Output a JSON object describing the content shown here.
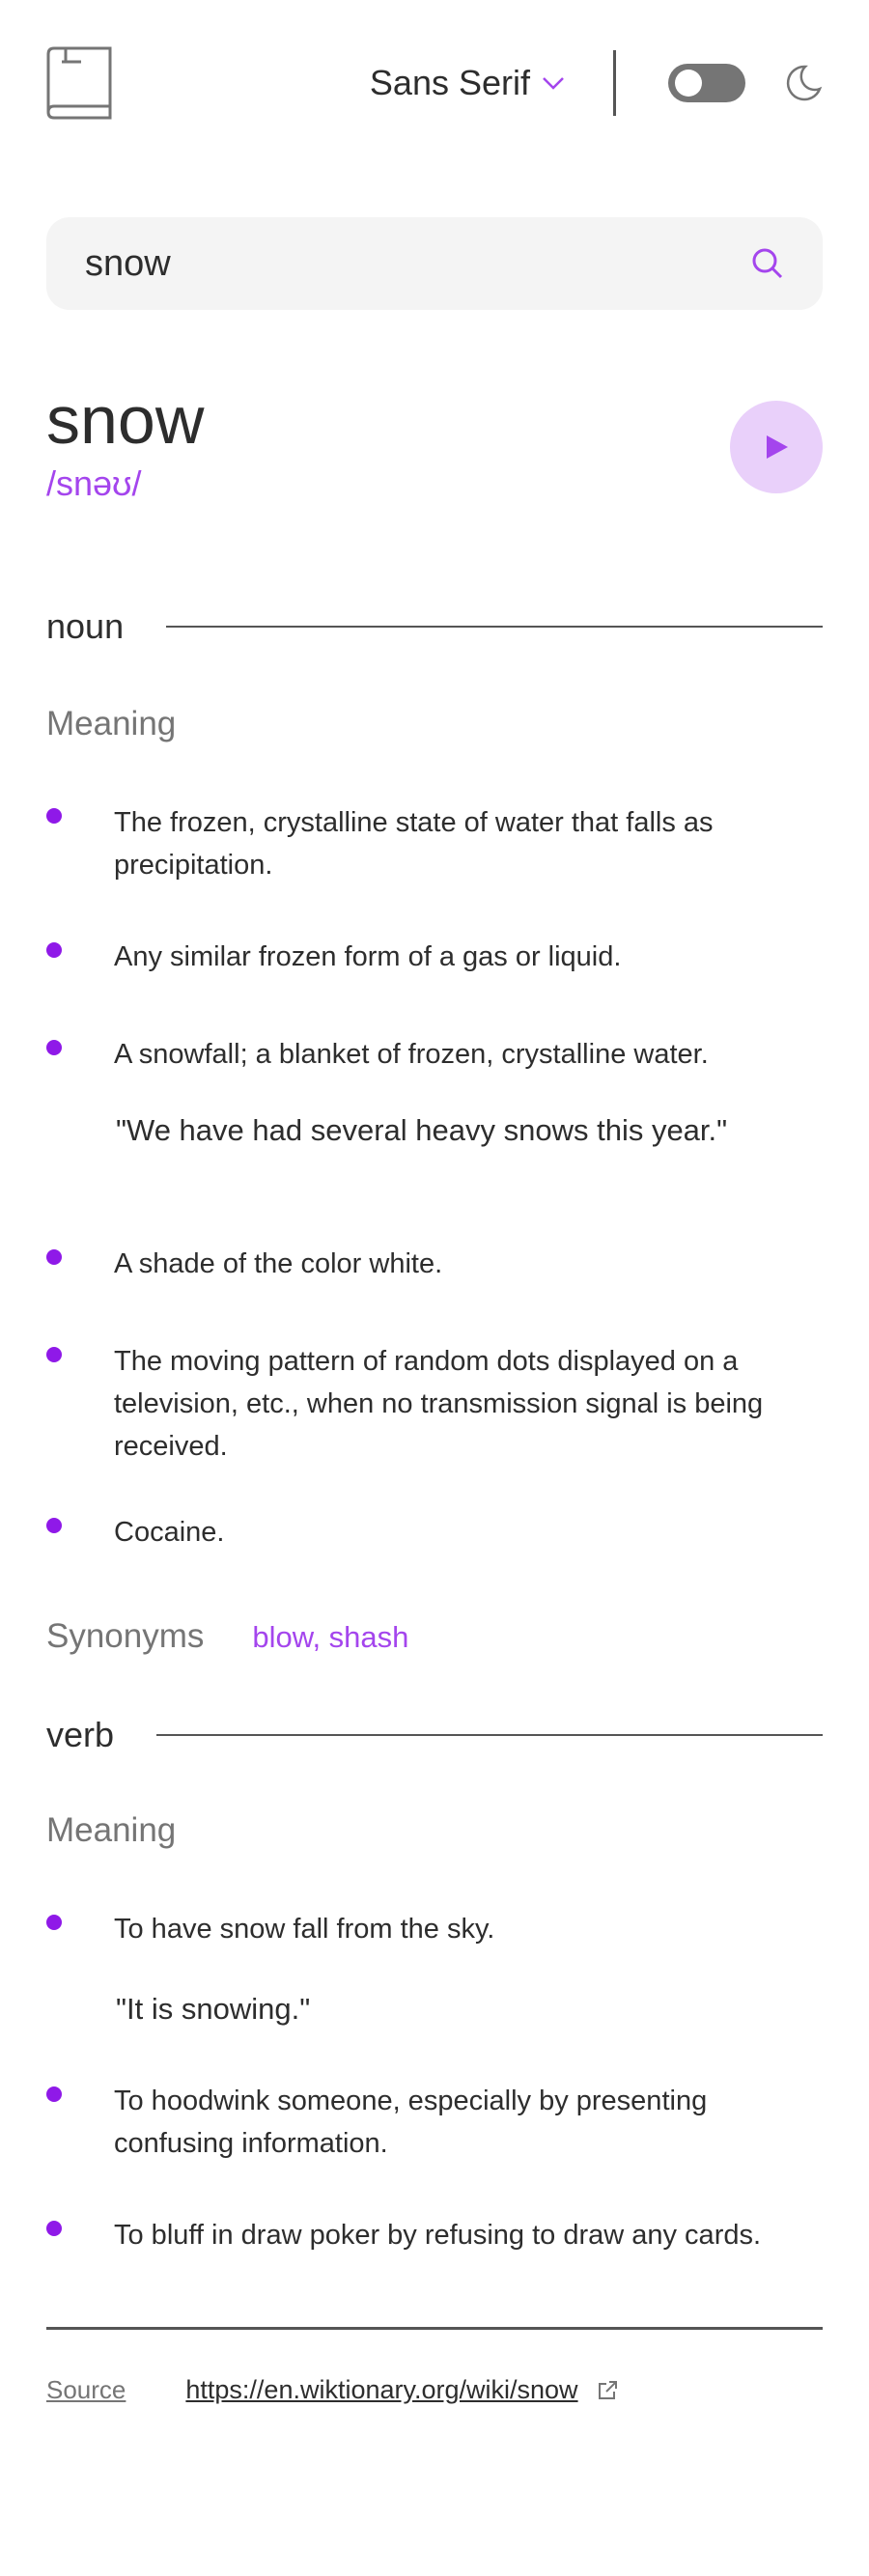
{
  "header": {
    "font_select_label": "Sans Serif",
    "icons": {
      "logo": "book-icon",
      "chevron": "chevron-down-icon",
      "moon": "moon-icon"
    }
  },
  "search": {
    "value": "snow",
    "icon": "search-icon"
  },
  "word": {
    "text": "snow",
    "phonetic": "/snəʊ/",
    "play_icon": "play-icon"
  },
  "meanings": [
    {
      "part_of_speech": "noun",
      "heading": "Meaning",
      "definitions": [
        {
          "text": "The frozen, crystalline state of water that falls as precipitation."
        },
        {
          "text": "Any similar frozen form of a gas or liquid."
        },
        {
          "text": "A snowfall; a blanket of frozen, crystalline water.",
          "example": "\"We have had several heavy snows this year.\""
        },
        {
          "text": "A shade of the color white."
        },
        {
          "text": "The moving pattern of random dots displayed on a television, etc., when no transmission signal is being received."
        },
        {
          "text": "Cocaine."
        }
      ],
      "synonyms_label": "Synonyms",
      "synonyms": "blow, shash"
    },
    {
      "part_of_speech": "verb",
      "heading": "Meaning",
      "definitions": [
        {
          "text": "To have snow fall from the sky.",
          "example": "\"It is snowing.\""
        },
        {
          "text": "To hoodwink someone, especially by presenting confusing information."
        },
        {
          "text": "To bluff in draw poker by refusing to draw any cards."
        }
      ]
    }
  ],
  "source": {
    "label": "Source",
    "url": "https://en.wiktionary.org/wiki/snow",
    "icon": "external-link-icon"
  },
  "colors": {
    "accent": "#a445ed",
    "bullet": "#8f19e8",
    "play_bg": "#e9d0fa",
    "search_bg": "#f4f4f4",
    "muted_text": "#757575",
    "text": "#2d2d2d"
  }
}
